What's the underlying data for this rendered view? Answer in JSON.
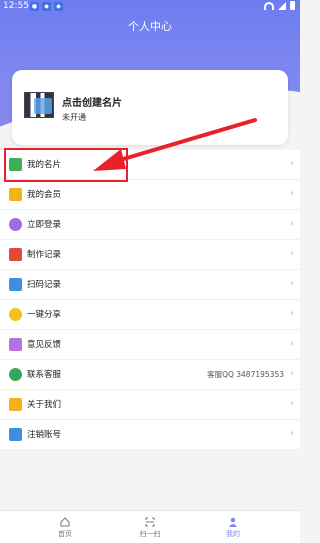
{
  "status": {
    "time": "12:55",
    "badges": [
      "●",
      "◆",
      "◆"
    ]
  },
  "header": {
    "title": "个人中心"
  },
  "card": {
    "title": "点击创建名片",
    "subtitle": "未开通"
  },
  "menu": [
    {
      "label": "我的名片",
      "icon": "business-card-icon",
      "color": "#3fae5a"
    },
    {
      "label": "我的会员",
      "icon": "crown-icon",
      "color": "#f2b21b"
    },
    {
      "label": "立即登录",
      "icon": "user-icon",
      "color": "#9a6fe0"
    },
    {
      "label": "制作记录",
      "icon": "pencil-icon",
      "color": "#e24a3f"
    },
    {
      "label": "扫码记录",
      "icon": "scan-icon",
      "color": "#3f8ee0"
    },
    {
      "label": "一键分享",
      "icon": "share-icon",
      "color": "#f2c21b"
    },
    {
      "label": "意见反馈",
      "icon": "feedback-icon",
      "color": "#b86fe0"
    },
    {
      "label": "联系客服",
      "icon": "service-icon",
      "color": "#35a65f",
      "value": "客服QQ 3487195353"
    },
    {
      "label": "关于我们",
      "icon": "about-icon",
      "color": "#f2b21b"
    },
    {
      "label": "注销账号",
      "icon": "logout-icon",
      "color": "#3f8ee0"
    }
  ],
  "tabs": [
    {
      "label": "首页"
    },
    {
      "label": "扫一扫"
    },
    {
      "label": "我的"
    }
  ],
  "colors": {
    "accent": "#6d7cf0",
    "highlight": "#e8222a"
  }
}
